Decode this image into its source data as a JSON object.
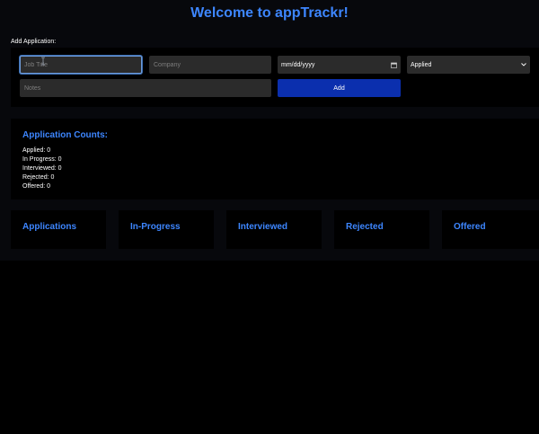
{
  "app": {
    "title": "Welcome to appTrackr!"
  },
  "form": {
    "section_label": "Add Application:",
    "job_title_placeholder": "Job Title",
    "company_placeholder": "Company",
    "date_placeholder": "mm/dd/yyyy",
    "status_selected": "Applied",
    "notes_placeholder": "Notes",
    "add_label": "Add"
  },
  "counts": {
    "title": "Application Counts:",
    "rows": [
      "Applied: 0",
      "In Progress: 0",
      "Interviewed: 0",
      "Rejected: 0",
      "Offered: 0"
    ]
  },
  "columns": [
    "Applications",
    "In-Progress",
    "Interviewed",
    "Rejected",
    "Offered"
  ],
  "colors": {
    "accent": "#3d86ff",
    "button": "#0b2fae",
    "field": "#2b2b2b",
    "background": "#000000"
  },
  "icons": {
    "date": "calendar-icon",
    "select": "chevron-down-icon",
    "cursor": "text-cursor-icon"
  }
}
